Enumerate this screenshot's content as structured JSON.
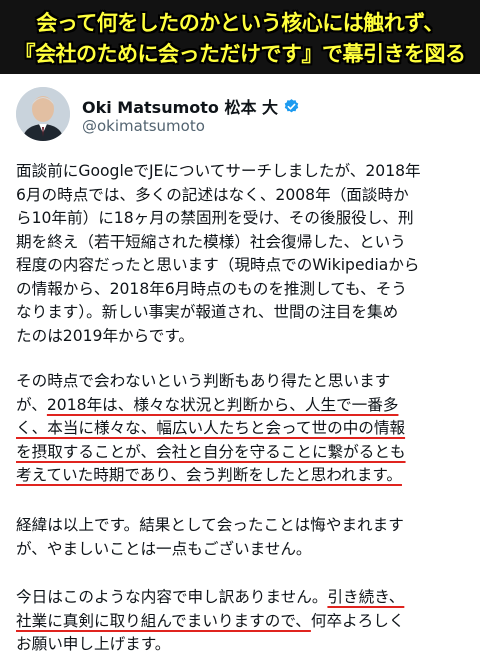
{
  "caption": {
    "line1": "会って何をしたのかという核心には触れず、",
    "line2": "『会社のために会っただけです』で幕引きを図る"
  },
  "profile": {
    "name": "Oki Matsumoto 松本 大",
    "handle": "@okimatsumoto",
    "verified_icon": "verified-badge-icon",
    "badge_color": "#1d9bf0"
  },
  "tweet": {
    "para1": [
      "面談前にGoogleでJEについてサーチしましたが、2018年",
      "6月の時点では、多くの記述はなく、2008年（面談時か",
      "ら10年前）に18ヶ月の禁固刑を受け、その後服役し、刑",
      "期を終え（若干短縮された模様）社会復帰した、という",
      "程度の内容だったと思います（現時点でのWikipediaから",
      "の情報から、2018年6月時点のものを推測しても、そう",
      "なります）。新しい事実が報道され、世間の注目を集め",
      "たのは2019年からです。"
    ],
    "para2": {
      "l1": "その時点で会わないという判断もあり得たと思います",
      "l2_pre": "が、",
      "l2_ul": "2018年は、様々な状況と判断から、人生で一番多",
      "l3": "く、本当に様々な、幅広い人たちと会って世の中の情報",
      "l4": "を摂取することが、会社と自分を守ることに繋がるとも",
      "l5": "考えていた時期であり、会う判断をしたと思われます。"
    },
    "para3": [
      "経緯は以上です。結果として会ったことは悔やまれます",
      "が、やましいことは一点もございません。"
    ],
    "para4": {
      "l1_pre": "今日はこのような内容で申し訳ありません。",
      "l1_ul": "引き続き、",
      "l2_ul": "社業に真剣に取り組んでまいりますので、",
      "l2_post": "何卒よろしく",
      "l3": "お願い申し上げます。"
    }
  },
  "colors": {
    "caption_text": "#ffff3c",
    "caption_bg": "#121212",
    "underline": "#e0241f",
    "handle": "#536471"
  }
}
